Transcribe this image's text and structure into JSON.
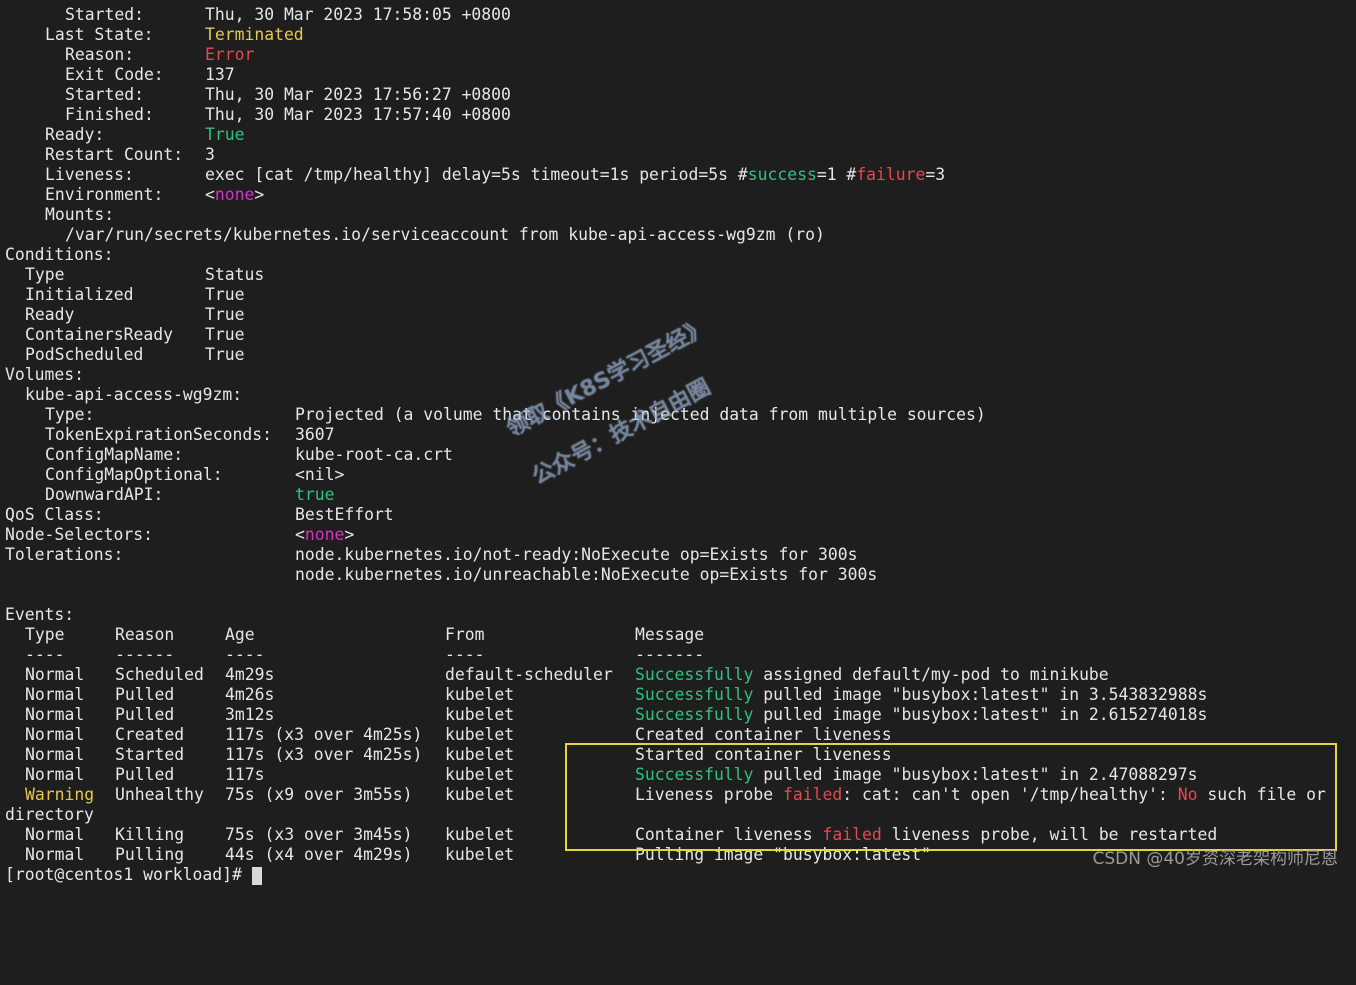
{
  "container": {
    "started_label": "Started:",
    "started_value": "Thu, 30 Mar 2023 17:58:05 +0800",
    "last_state_label": "Last State:",
    "last_state_value": "Terminated",
    "reason_label": "Reason:",
    "reason_value": "Error",
    "exit_code_label": "Exit Code:",
    "exit_code_value": "137",
    "prev_started_label": "Started:",
    "prev_started_value": "Thu, 30 Mar 2023 17:56:27 +0800",
    "finished_label": "Finished:",
    "finished_value": "Thu, 30 Mar 2023 17:57:40 +0800",
    "ready_label": "Ready:",
    "ready_value": "True",
    "restart_label": "Restart Count:",
    "restart_value": "3",
    "liveness_label": "Liveness:",
    "liveness_a": "exec [cat /tmp/healthy] delay=5s timeout=1s period=5s #",
    "liveness_success": "success",
    "liveness_b": "=1 #",
    "liveness_failure": "failure",
    "liveness_c": "=3",
    "env_label": "Environment:",
    "env_open": "<",
    "env_none": "none",
    "env_close": ">",
    "mounts_label": "Mounts:",
    "mount_path": "/var/run/secrets/kubernetes.io/serviceaccount from kube-api-access-wg9zm (ro)"
  },
  "conditions": {
    "heading": "Conditions:",
    "col_type": "Type",
    "col_status": "Status",
    "rows": [
      {
        "type": "Initialized",
        "status": "True"
      },
      {
        "type": "Ready",
        "status": "True"
      },
      {
        "type": "ContainersReady",
        "status": "True"
      },
      {
        "type": "PodScheduled",
        "status": "True"
      }
    ]
  },
  "volumes": {
    "heading": "Volumes:",
    "name": "kube-api-access-wg9zm:",
    "type_label": "Type:",
    "type_value": "Projected (a volume that contains injected data from multiple sources)",
    "token_label": "TokenExpirationSeconds:",
    "token_value": "3607",
    "cm_name_label": "ConfigMapName:",
    "cm_name_value": "kube-root-ca.crt",
    "cm_opt_label": "ConfigMapOptional:",
    "cm_opt_value": "<nil>",
    "downward_label": "DownwardAPI:",
    "downward_value": "true"
  },
  "qos": {
    "label": "QoS Class:",
    "value": "BestEffort"
  },
  "node_selectors": {
    "label": "Node-Selectors:",
    "open": "<",
    "none": "none",
    "close": ">"
  },
  "tolerations": {
    "label": "Tolerations:",
    "line1": "node.kubernetes.io/not-ready:NoExecute op=Exists for 300s",
    "line2": "node.kubernetes.io/unreachable:NoExecute op=Exists for 300s"
  },
  "events": {
    "heading": "Events:",
    "col_type": "Type",
    "col_reason": "Reason",
    "col_age": "Age",
    "col_from": "From",
    "col_message": "Message",
    "sep_type": "----",
    "sep_reason": "------",
    "sep_age": "----",
    "sep_from": "----",
    "sep_message": "-------",
    "rows": [
      {
        "type": "Normal",
        "reason": "Scheduled",
        "age": "4m29s",
        "from": "default-scheduler",
        "msg_hl": "Successfully",
        "msg_rest": " assigned default/my-pod to minikube"
      },
      {
        "type": "Normal",
        "reason": "Pulled",
        "age": "4m26s",
        "from": "kubelet",
        "msg_hl": "Successfully",
        "msg_rest": " pulled image \"busybox:latest\" in 3.543832988s"
      },
      {
        "type": "Normal",
        "reason": "Pulled",
        "age": "3m12s",
        "from": "kubelet",
        "msg_hl": "Successfully",
        "msg_rest": " pulled image \"busybox:latest\" in 2.615274018s"
      },
      {
        "type": "Normal",
        "reason": "Created",
        "age": "117s (x3 over 4m25s)",
        "from": "kubelet",
        "msg_hl": "",
        "msg_rest": "Created container liveness"
      },
      {
        "type": "Normal",
        "reason": "Started",
        "age": "117s (x3 over 4m25s)",
        "from": "kubelet",
        "msg_hl": "",
        "msg_rest": "Started container liveness"
      },
      {
        "type": "Normal",
        "reason": "Pulled",
        "age": "117s",
        "from": "kubelet",
        "msg_hl": "Successfully",
        "msg_rest": " pulled image \"busybox:latest\" in 2.47088297s"
      }
    ],
    "warning": {
      "type": "Warning",
      "reason": "Unhealthy",
      "age": "75s (x9 over 3m55s)",
      "from": "kubelet",
      "msg_a": "Liveness probe ",
      "msg_failed": "failed",
      "msg_b": ": cat: can't open '/tmp/healthy': ",
      "msg_no": "No",
      "msg_c": " such file or",
      "wrap": "directory"
    },
    "killing": {
      "type": "Normal",
      "reason": "Killing",
      "age": "75s (x3 over 3m45s)",
      "from": "kubelet",
      "msg_a": "Container liveness ",
      "msg_failed": "failed",
      "msg_b": " liveness probe, will be restarted"
    },
    "pulling": {
      "type": "Normal",
      "reason": "Pulling",
      "age": "44s (x4 over 4m29s)",
      "from": "kubelet",
      "msg": "Pulling image \"busybox:latest\""
    }
  },
  "prompt": {
    "text": "[root@centos1 workload]# "
  },
  "watermark": {
    "line1": "领取《K8S学习圣经》",
    "line2": "公众号：技术自由圈"
  },
  "footer": {
    "csdn": "CSDN @40岁资深老架构师尼恩"
  },
  "colors": {
    "green": "#2ec27e",
    "red": "#e5484d",
    "yellow": "#e5c84a",
    "magenta": "#d233c8",
    "highlight_box": "#e6d43a"
  }
}
